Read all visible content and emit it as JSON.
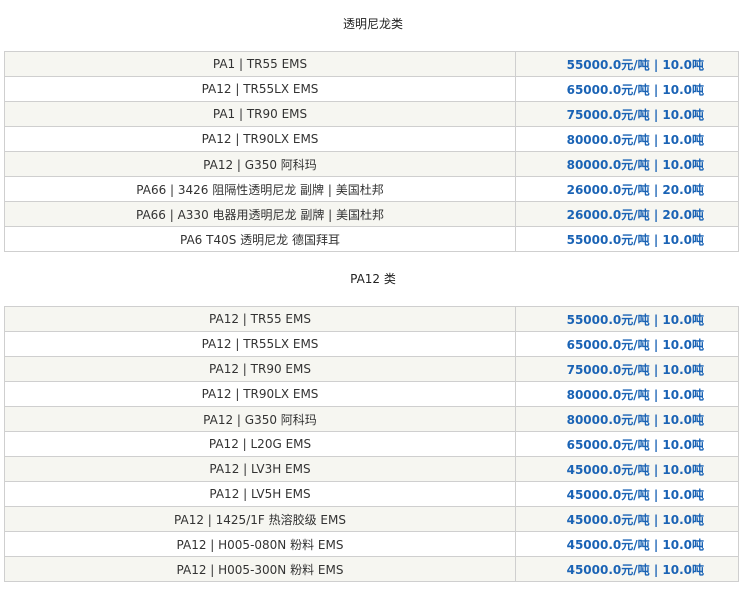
{
  "sections": [
    {
      "title": "透明尼龙类",
      "rows": [
        {
          "name": "PA1 | TR55 EMS",
          "price": "55000.0元/吨 | 10.0吨"
        },
        {
          "name": "PA12 | TR55LX EMS",
          "price": "65000.0元/吨 | 10.0吨"
        },
        {
          "name": "PA1 | TR90 EMS",
          "price": "75000.0元/吨 | 10.0吨"
        },
        {
          "name": "PA12 | TR90LX EMS",
          "price": "80000.0元/吨 | 10.0吨"
        },
        {
          "name": "PA12 | G350 阿科玛",
          "price": "80000.0元/吨 | 10.0吨"
        },
        {
          "name": "PA66 | 3426 阻隔性透明尼龙 副牌 | 美国杜邦",
          "price": "26000.0元/吨 | 20.0吨"
        },
        {
          "name": "PA66 | A330 电器用透明尼龙 副牌 | 美国杜邦",
          "price": "26000.0元/吨 | 20.0吨"
        },
        {
          "name": "PA6 T40S 透明尼龙 德国拜耳",
          "price": "55000.0元/吨 | 10.0吨"
        }
      ]
    },
    {
      "title": "PA12 类",
      "rows": [
        {
          "name": "PA12 | TR55 EMS",
          "price": "55000.0元/吨 | 10.0吨"
        },
        {
          "name": "PA12 | TR55LX EMS",
          "price": "65000.0元/吨 | 10.0吨"
        },
        {
          "name": "PA12 | TR90 EMS",
          "price": "75000.0元/吨 | 10.0吨"
        },
        {
          "name": "PA12 | TR90LX EMS",
          "price": "80000.0元/吨 | 10.0吨"
        },
        {
          "name": "PA12 | G350 阿科玛",
          "price": "80000.0元/吨 | 10.0吨"
        },
        {
          "name": "PA12 | L20G EMS",
          "price": "65000.0元/吨 | 10.0吨"
        },
        {
          "name": "PA12 | LV3H EMS",
          "price": "45000.0元/吨 | 10.0吨"
        },
        {
          "name": "PA12 | LV5H EMS",
          "price": "45000.0元/吨 | 10.0吨"
        },
        {
          "name": "PA12 | 1425/1F 热溶胶级 EMS",
          "price": "45000.0元/吨 | 10.0吨"
        },
        {
          "name": "PA12 | H005-080N 粉料 EMS",
          "price": "45000.0元/吨 | 10.0吨"
        },
        {
          "name": "PA12 | H005-300N 粉料 EMS",
          "price": "45000.0元/吨 | 10.0吨"
        }
      ]
    }
  ]
}
